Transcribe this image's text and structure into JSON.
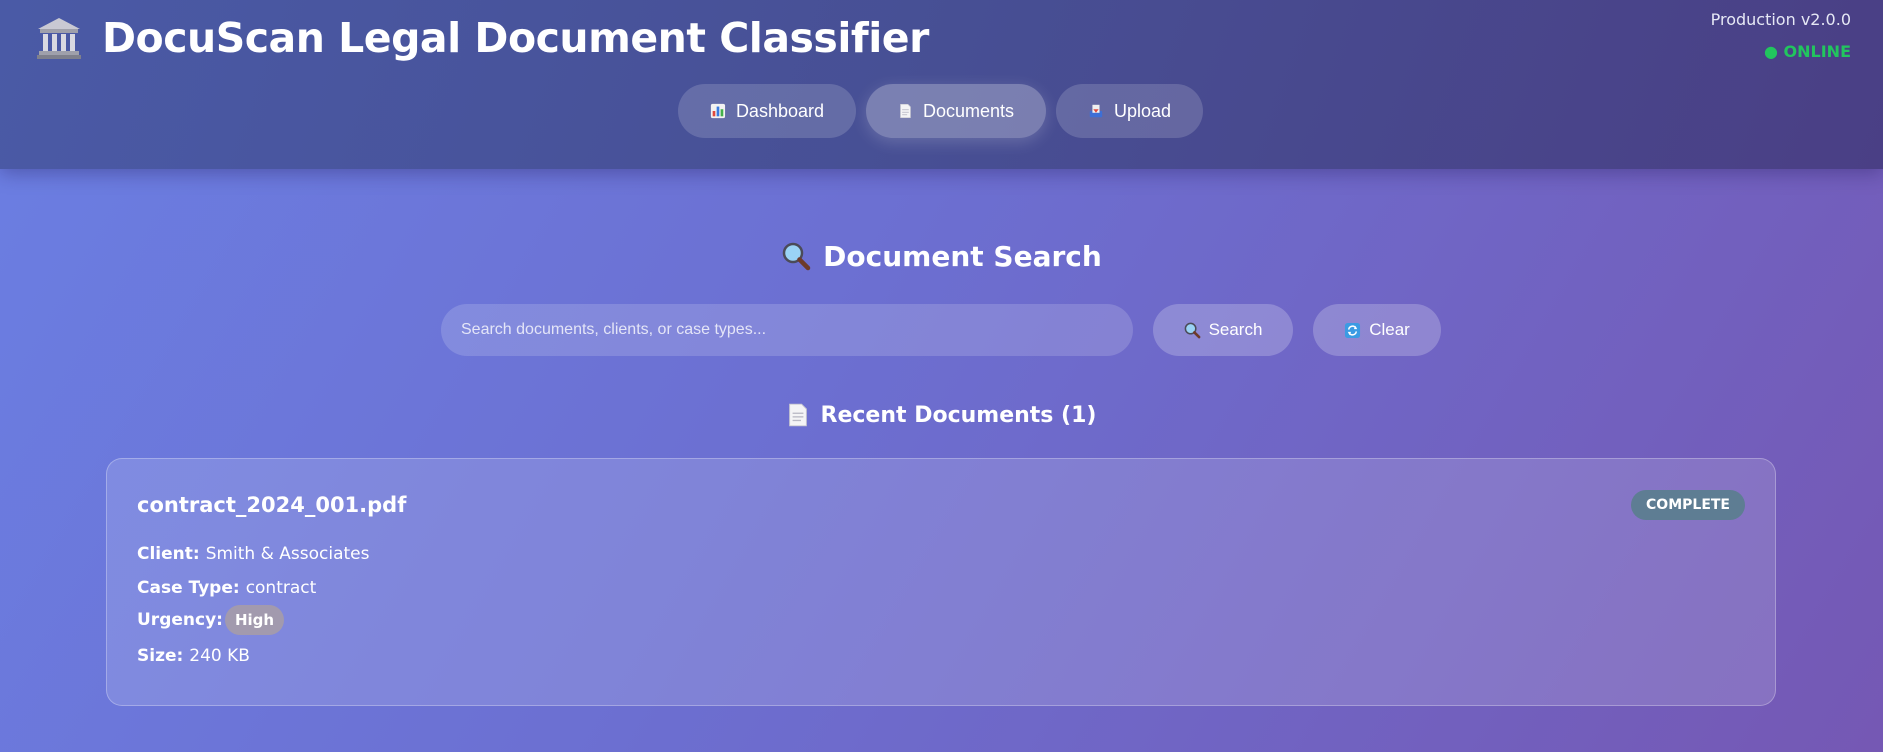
{
  "header": {
    "title": "DocuScan Legal Document Classifier",
    "logo_icon": "bank-icon",
    "env_version": "Production v2.0.0",
    "status": "● ONLINE",
    "status_color": "#22c55e"
  },
  "nav": {
    "items": [
      {
        "label": "Dashboard",
        "icon": "bar-chart-icon",
        "active": false
      },
      {
        "label": "Documents",
        "icon": "page-icon",
        "active": true
      },
      {
        "label": "Upload",
        "icon": "inbox-tray-icon",
        "active": false
      }
    ]
  },
  "search": {
    "title": "Document Search",
    "title_icon": "magnifier-icon",
    "placeholder": "Search documents, clients, or case types...",
    "value": "",
    "search_label": "Search",
    "clear_label": "Clear"
  },
  "recent": {
    "title": "Recent Documents (1)",
    "title_icon": "page-icon",
    "documents": [
      {
        "name": "contract_2024_001.pdf",
        "status": "COMPLETE",
        "status_color": "#5e7d93",
        "client_label": "Client:",
        "client": "Smith & Associates",
        "case_type_label": "Case Type:",
        "case_type": "contract",
        "urgency_label": "Urgency:",
        "urgency": "High",
        "urgency_color": "#a29aae",
        "size_label": "Size:",
        "size": "240 KB"
      }
    ]
  }
}
